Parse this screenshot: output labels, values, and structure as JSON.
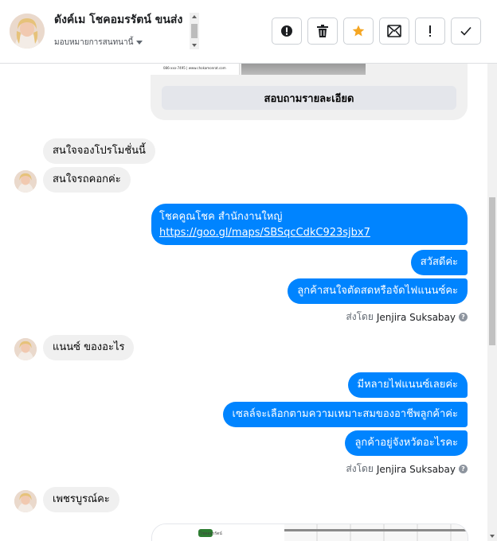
{
  "header": {
    "contact_name": "ดังค์เม โชคอมรรัตน์ ขนส่ง",
    "assign_label": "มอบหมายการสนทนานี้",
    "actions": [
      {
        "icon": "alert-circle-icon",
        "name": "spam-button"
      },
      {
        "icon": "trash-icon",
        "name": "delete-button"
      },
      {
        "icon": "star-icon",
        "name": "star-button"
      },
      {
        "icon": "mark-unread-icon",
        "name": "mark-unread-button"
      },
      {
        "icon": "exclamation-icon",
        "name": "follow-up-button"
      },
      {
        "icon": "check-icon",
        "name": "done-button"
      }
    ]
  },
  "card": {
    "image_caption": "086-xxx-7495 | www.chokamonrat.com",
    "cta_label": "สอบถามรายละเอียด"
  },
  "messages": [
    {
      "dir": "in",
      "text": "สนใจจองโปรโมชั่นนี้"
    },
    {
      "dir": "in",
      "text": "สนใจรถคอกค่ะ"
    },
    {
      "dir": "out",
      "text": "โชคคูณโชค สำนักงานใหญ่",
      "link": "https://goo.gl/maps/SBSqcCdkC923sjbx7"
    },
    {
      "dir": "out",
      "text": "สวัสดีค่ะ"
    },
    {
      "dir": "out",
      "text": "ลูกค้าสนใจตัดสดหรือจัดไฟแนนซ์คะ"
    },
    {
      "dir": "in",
      "text": "แนนซ์ ของอะไร"
    },
    {
      "dir": "out",
      "text": "มีหลายไฟแนนซ์เลยค่ะ"
    },
    {
      "dir": "out",
      "text": "เซลล์จะเลือกตามความเหมาะสมของอาชีพลูกค้าค่ะ"
    },
    {
      "dir": "out",
      "text": "ลูกค้าอยู่จังหวัดอะไรคะ"
    },
    {
      "dir": "in",
      "text": "เพชรบูรณ์คะ"
    }
  ],
  "sent_by": {
    "prefix": "ส่งโดย",
    "agent": "Jenjira Suksabay",
    "help": "?"
  },
  "card2": {
    "tiny_logo_text": "โชคอมรรัตน์"
  },
  "colors": {
    "outgoing_bubble": "#0084ff",
    "incoming_bubble": "#f0f0f0",
    "star": "#f5a623"
  }
}
